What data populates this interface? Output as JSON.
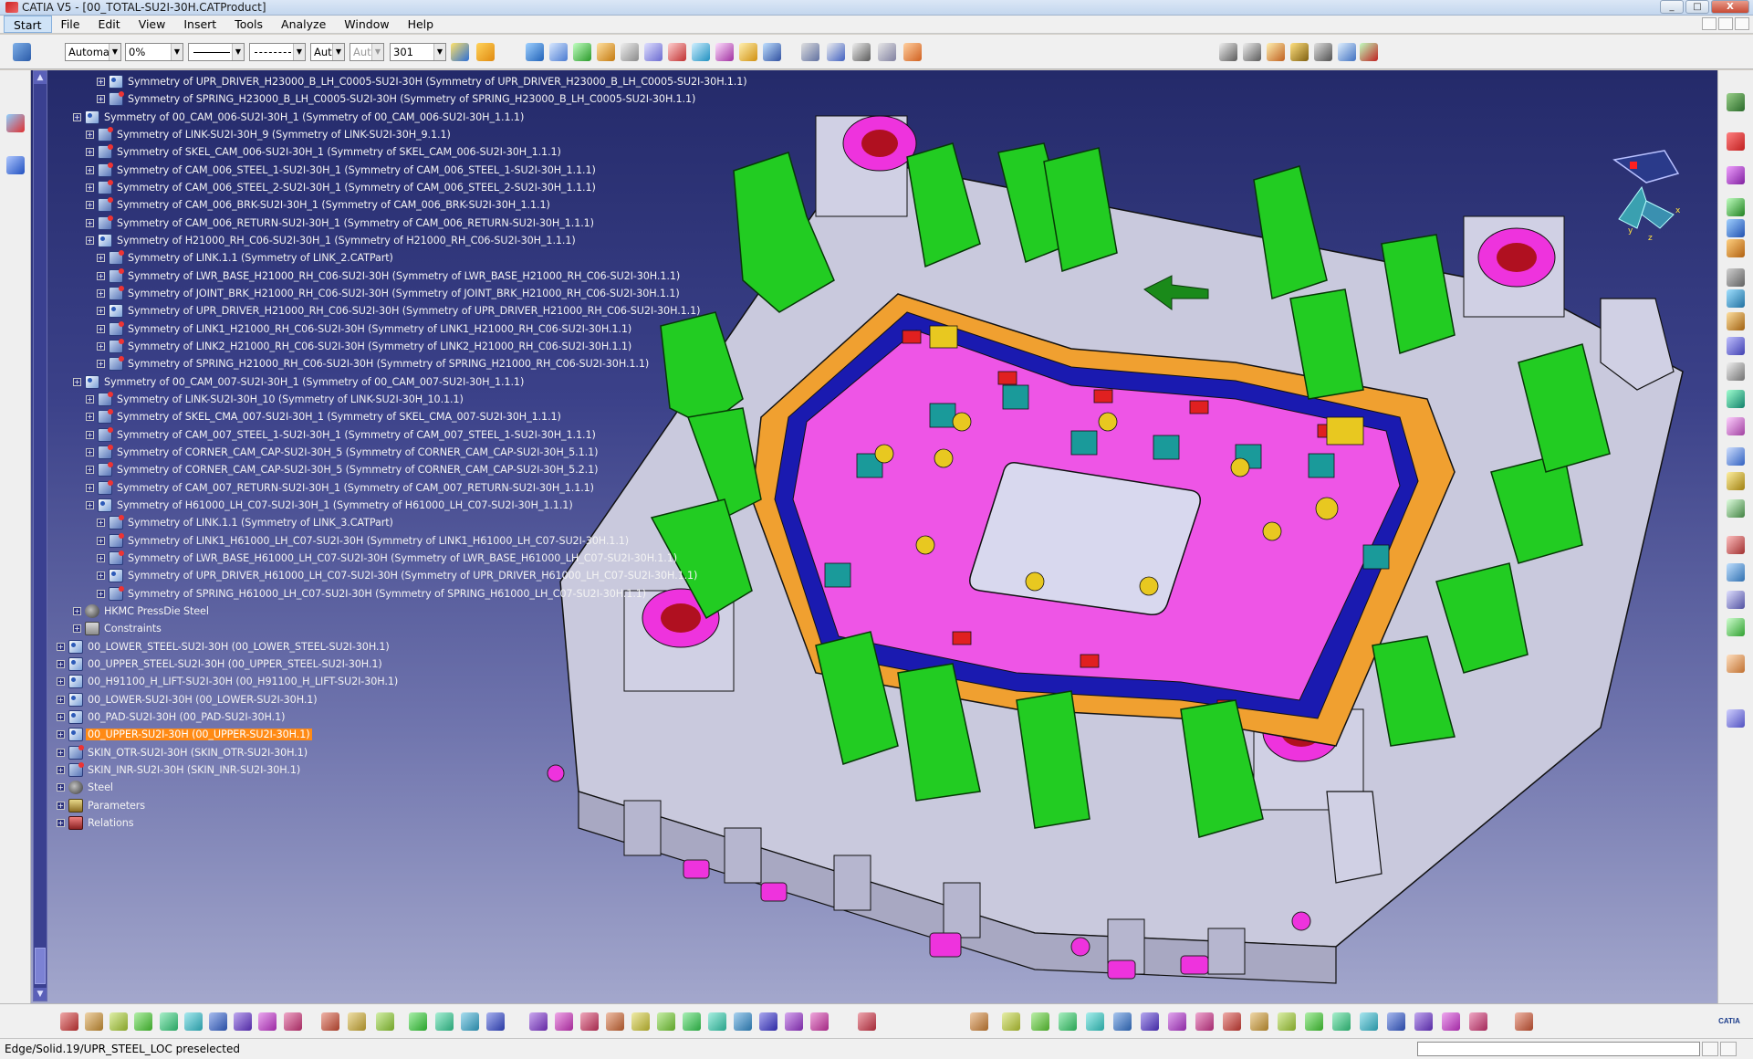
{
  "window": {
    "title": "CATIA V5 - [00_TOTAL-SU2I-30H.CATProduct]",
    "min_label": "_",
    "max_label": "□",
    "close_label": "X"
  },
  "menu": {
    "items": [
      "Start",
      "File",
      "Edit",
      "View",
      "Insert",
      "Tools",
      "Analyze",
      "Window",
      "Help"
    ]
  },
  "toolbar": {
    "color_combo": "Automa",
    "transparency_combo": "0%",
    "line_thickness_combo": "Aut",
    "point_type_combo": "Aut",
    "layer_combo": "301"
  },
  "tree": {
    "items": [
      {
        "level": 3,
        "icon": "product",
        "label": "Symmetry of UPR_DRIVER_H23000_B_LH_C0005-SU2I-30H (Symmetry of UPR_DRIVER_H23000_B_LH_C0005-SU2I-30H.1.1)"
      },
      {
        "level": 3,
        "icon": "part",
        "label": "Symmetry of SPRING_H23000_B_LH_C0005-SU2I-30H (Symmetry of SPRING_H23000_B_LH_C0005-SU2I-30H.1.1)"
      },
      {
        "level": 1,
        "icon": "product",
        "label": "Symmetry of 00_CAM_006-SU2I-30H_1 (Symmetry of 00_CAM_006-SU2I-30H_1.1.1)"
      },
      {
        "level": 2,
        "icon": "part",
        "label": "Symmetry of LINK-SU2I-30H_9 (Symmetry of LINK-SU2I-30H_9.1.1)"
      },
      {
        "level": 2,
        "icon": "part",
        "label": "Symmetry of SKEL_CAM_006-SU2I-30H_1 (Symmetry of SKEL_CAM_006-SU2I-30H_1.1.1)"
      },
      {
        "level": 2,
        "icon": "part",
        "label": "Symmetry of CAM_006_STEEL_1-SU2I-30H_1 (Symmetry of CAM_006_STEEL_1-SU2I-30H_1.1.1)"
      },
      {
        "level": 2,
        "icon": "part",
        "label": "Symmetry of CAM_006_STEEL_2-SU2I-30H_1 (Symmetry of CAM_006_STEEL_2-SU2I-30H_1.1.1)"
      },
      {
        "level": 2,
        "icon": "part",
        "label": "Symmetry of CAM_006_BRK-SU2I-30H_1 (Symmetry of CAM_006_BRK-SU2I-30H_1.1.1)"
      },
      {
        "level": 2,
        "icon": "part",
        "label": "Symmetry of CAM_006_RETURN-SU2I-30H_1 (Symmetry of CAM_006_RETURN-SU2I-30H_1.1.1)"
      },
      {
        "level": 2,
        "icon": "product",
        "label": "Symmetry of H21000_RH_C06-SU2I-30H_1 (Symmetry of H21000_RH_C06-SU2I-30H_1.1.1)"
      },
      {
        "level": 3,
        "icon": "part",
        "label": "Symmetry of LINK.1.1 (Symmetry of LINK_2.CATPart)"
      },
      {
        "level": 3,
        "icon": "part",
        "label": "Symmetry of LWR_BASE_H21000_RH_C06-SU2I-30H (Symmetry of LWR_BASE_H21000_RH_C06-SU2I-30H.1.1)"
      },
      {
        "level": 3,
        "icon": "part",
        "label": "Symmetry of JOINT_BRK_H21000_RH_C06-SU2I-30H (Symmetry of JOINT_BRK_H21000_RH_C06-SU2I-30H.1.1)"
      },
      {
        "level": 3,
        "icon": "product",
        "label": "Symmetry of UPR_DRIVER_H21000_RH_C06-SU2I-30H (Symmetry of UPR_DRIVER_H21000_RH_C06-SU2I-30H.1.1)"
      },
      {
        "level": 3,
        "icon": "part",
        "label": "Symmetry of LINK1_H21000_RH_C06-SU2I-30H (Symmetry of LINK1_H21000_RH_C06-SU2I-30H.1.1)"
      },
      {
        "level": 3,
        "icon": "part",
        "label": "Symmetry of LINK2_H21000_RH_C06-SU2I-30H (Symmetry of LINK2_H21000_RH_C06-SU2I-30H.1.1)"
      },
      {
        "level": 3,
        "icon": "part",
        "label": "Symmetry of SPRING_H21000_RH_C06-SU2I-30H (Symmetry of SPRING_H21000_RH_C06-SU2I-30H.1.1)"
      },
      {
        "level": 1,
        "icon": "product",
        "label": "Symmetry of 00_CAM_007-SU2I-30H_1 (Symmetry of 00_CAM_007-SU2I-30H_1.1.1)"
      },
      {
        "level": 2,
        "icon": "part",
        "label": "Symmetry of LINK-SU2I-30H_10 (Symmetry of LINK-SU2I-30H_10.1.1)"
      },
      {
        "level": 2,
        "icon": "part",
        "label": "Symmetry of SKEL_CMA_007-SU2I-30H_1 (Symmetry of SKEL_CMA_007-SU2I-30H_1.1.1)"
      },
      {
        "level": 2,
        "icon": "part",
        "label": "Symmetry of CAM_007_STEEL_1-SU2I-30H_1 (Symmetry of CAM_007_STEEL_1-SU2I-30H_1.1.1)"
      },
      {
        "level": 2,
        "icon": "part",
        "label": "Symmetry of CORNER_CAM_CAP-SU2I-30H_5 (Symmetry of CORNER_CAM_CAP-SU2I-30H_5.1.1)"
      },
      {
        "level": 2,
        "icon": "part",
        "label": "Symmetry of CORNER_CAM_CAP-SU2I-30H_5 (Symmetry of CORNER_CAM_CAP-SU2I-30H_5.2.1)"
      },
      {
        "level": 2,
        "icon": "part",
        "label": "Symmetry of CAM_007_RETURN-SU2I-30H_1 (Symmetry of CAM_007_RETURN-SU2I-30H_1.1.1)"
      },
      {
        "level": 2,
        "icon": "product",
        "label": "Symmetry of H61000_LH_C07-SU2I-30H_1 (Symmetry of H61000_LH_C07-SU2I-30H_1.1.1)"
      },
      {
        "level": 3,
        "icon": "part",
        "label": "Symmetry of LINK.1.1 (Symmetry of LINK_3.CATPart)"
      },
      {
        "level": 3,
        "icon": "part",
        "label": "Symmetry of LINK1_H61000_LH_C07-SU2I-30H (Symmetry of LINK1_H61000_LH_C07-SU2I-30H.1.1)"
      },
      {
        "level": 3,
        "icon": "part",
        "label": "Symmetry of LWR_BASE_H61000_LH_C07-SU2I-30H (Symmetry of LWR_BASE_H61000_LH_C07-SU2I-30H.1.1)"
      },
      {
        "level": 3,
        "icon": "product",
        "label": "Symmetry of UPR_DRIVER_H61000_LH_C07-SU2I-30H (Symmetry of UPR_DRIVER_H61000_LH_C07-SU2I-30H.1.1)"
      },
      {
        "level": 3,
        "icon": "part",
        "label": "Symmetry of SPRING_H61000_LH_C07-SU2I-30H (Symmetry of SPRING_H61000_LH_C07-SU2I-30H.1.1)"
      },
      {
        "level": 1,
        "icon": "material",
        "label": "HKMC PressDie Steel"
      },
      {
        "level": 1,
        "icon": "constraint",
        "label": "Constraints"
      },
      {
        "level": 0,
        "icon": "product",
        "label": "00_LOWER_STEEL-SU2I-30H (00_LOWER_STEEL-SU2I-30H.1)"
      },
      {
        "level": 0,
        "icon": "product",
        "label": "00_UPPER_STEEL-SU2I-30H (00_UPPER_STEEL-SU2I-30H.1)"
      },
      {
        "level": 0,
        "icon": "product",
        "label": "00_H91100_H_LIFT-SU2I-30H (00_H91100_H_LIFT-SU2I-30H.1)"
      },
      {
        "level": 0,
        "icon": "product",
        "label": "00_LOWER-SU2I-30H (00_LOWER-SU2I-30H.1)"
      },
      {
        "level": 0,
        "icon": "product",
        "label": "00_PAD-SU2I-30H (00_PAD-SU2I-30H.1)"
      },
      {
        "level": 0,
        "icon": "product",
        "label": "00_UPPER-SU2I-30H (00_UPPER-SU2I-30H.1)",
        "highlight": true
      },
      {
        "level": 0,
        "icon": "part",
        "label": "SKIN_OTR-SU2I-30H (SKIN_OTR-SU2I-30H.1)"
      },
      {
        "level": 0,
        "icon": "part",
        "label": "SKIN_INR-SU2I-30H (SKIN_INR-SU2I-30H.1)"
      },
      {
        "level": 0,
        "icon": "material",
        "label": "Steel"
      },
      {
        "level": 0,
        "icon": "param",
        "label": "Parameters"
      },
      {
        "level": 0,
        "icon": "relation",
        "label": "Relations"
      }
    ]
  },
  "compass_axes": {
    "x": "x",
    "y": "y",
    "z": "z"
  },
  "status": {
    "message": "Edge/Solid.19/UPR_STEEL_LOC preselected"
  },
  "brand": {
    "logo_text": "CATIA"
  },
  "colors": {
    "highlight": "#ff8a14",
    "viewport_top": "#242a6a",
    "viewport_bottom": "#a3a7cc",
    "green_parts": "#22cc22",
    "magenta_parts": "#ee33dd",
    "orange_parts": "#f0a030"
  }
}
